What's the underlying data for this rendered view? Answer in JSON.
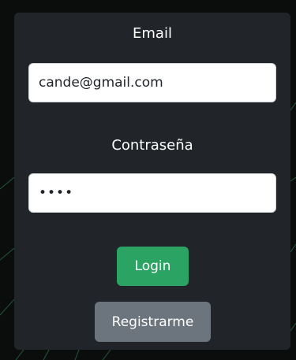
{
  "form": {
    "email_label": "Email",
    "email_value": "cande@gmail.com",
    "password_label": "Contraseña",
    "password_value": "cand",
    "login_label": "Login",
    "register_label": "Registrarme"
  },
  "colors": {
    "page_background": "#0b0d0c",
    "card_background": "#212529",
    "login_button": "#2aa363",
    "register_button": "#6c757d"
  }
}
